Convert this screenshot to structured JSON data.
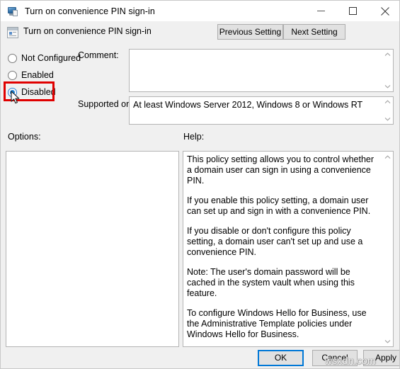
{
  "window": {
    "title": "Turn on convenience PIN sign-in",
    "icon": "policy-setting-icon",
    "controls": {
      "minimize": "minimize-icon",
      "maximize": "maximize-icon",
      "close": "close-icon"
    }
  },
  "header": {
    "title": "Turn on convenience PIN sign-in",
    "icon": "group-policy-icon",
    "previous_setting_label": "Previous Setting",
    "next_setting_label": "Next Setting"
  },
  "state": {
    "options": [
      {
        "id": "not-configured",
        "label": "Not Configured",
        "selected": false
      },
      {
        "id": "enabled",
        "label": "Enabled",
        "selected": false
      },
      {
        "id": "disabled",
        "label": "Disabled",
        "selected": true
      }
    ],
    "highlighted_option": "Disabled",
    "highlight_color": "#e00000"
  },
  "comment": {
    "label": "Comment:",
    "value": "",
    "placeholder": ""
  },
  "supported_on": {
    "label": "Supported on:",
    "value": "At least Windows Server 2012, Windows 8 or Windows RT"
  },
  "panels": {
    "options_label": "Options:",
    "options_content": "",
    "help_label": "Help:",
    "help_paragraphs": [
      "This policy setting allows you to control whether a domain user can sign in using a convenience PIN.",
      "If you enable this policy setting, a domain user can set up and sign in with a convenience PIN.",
      "If you disable or don't configure this policy setting, a domain user can't set up and use a convenience PIN.",
      "Note: The user's domain password will be cached in the system vault when using this feature.",
      "To configure Windows Hello for Business, use the Administrative Template policies under Windows Hello for Business."
    ]
  },
  "footer": {
    "ok_label": "OK",
    "cancel_label": "Cancel",
    "apply_label": "Apply"
  },
  "watermark": {
    "text": "wsxdn.com"
  }
}
